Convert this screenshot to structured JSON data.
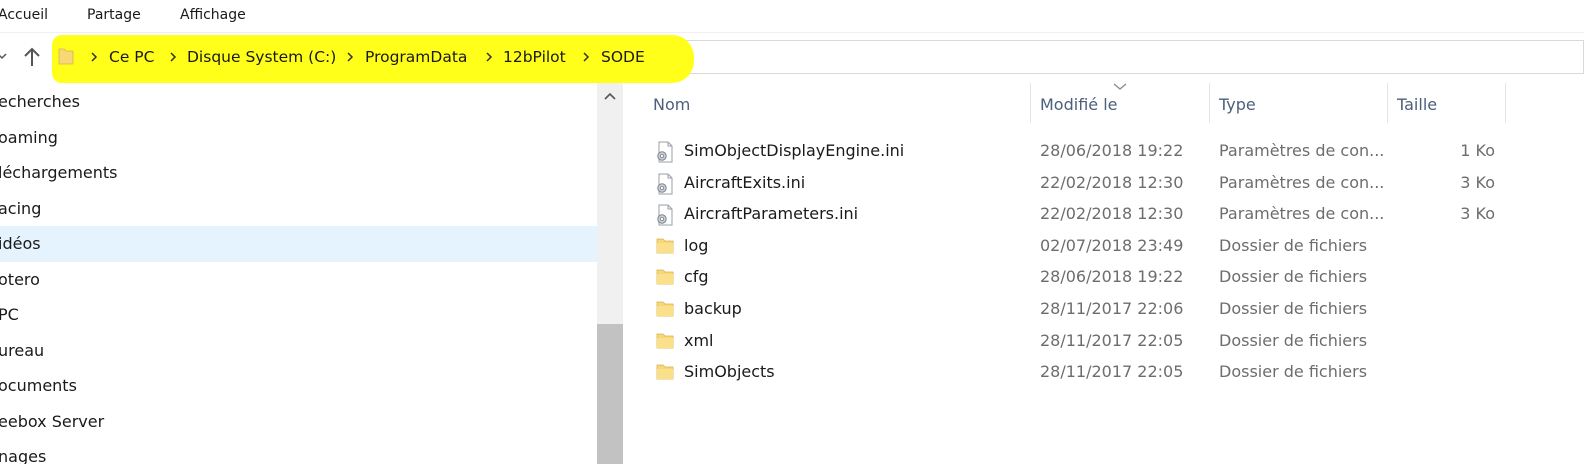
{
  "ribbon": {
    "tabs": [
      "Accueil",
      "Partage",
      "Affichage"
    ]
  },
  "address": {
    "breadcrumbs": [
      "Ce PC",
      "Disque System (C:)",
      "ProgramData",
      "12bPilot",
      "SODE"
    ],
    "highlight_color": "#ffff1a"
  },
  "nav_pane": {
    "items": [
      {
        "label": "echerches",
        "selected": false
      },
      {
        "label": "oaming",
        "selected": false
      },
      {
        "label": "léchargements",
        "selected": false
      },
      {
        "label": "acing",
        "selected": false
      },
      {
        "label": "idéos",
        "selected": true
      },
      {
        "label": "otero",
        "selected": false
      },
      {
        "label": "PC",
        "selected": false
      },
      {
        "label": "ureau",
        "selected": false
      },
      {
        "label": "ocuments",
        "selected": false
      },
      {
        "label": "eebox Server",
        "selected": false
      },
      {
        "label": "nages",
        "selected": false
      }
    ]
  },
  "columns": {
    "name": "Nom",
    "modified": "Modifié le",
    "type": "Type",
    "size": "Taille"
  },
  "files": [
    {
      "name": "SimObjectDisplayEngine.ini",
      "modified": "28/06/2018 19:22",
      "type": "Paramètres de con...",
      "size": "1 Ko",
      "icon": "ini-file-icon"
    },
    {
      "name": "AircraftExits.ini",
      "modified": "22/02/2018 12:30",
      "type": "Paramètres de con...",
      "size": "3 Ko",
      "icon": "ini-file-icon"
    },
    {
      "name": "AircraftParameters.ini",
      "modified": "22/02/2018 12:30",
      "type": "Paramètres de con...",
      "size": "3 Ko",
      "icon": "ini-file-icon"
    },
    {
      "name": "log",
      "modified": "02/07/2018 23:49",
      "type": "Dossier de fichiers",
      "size": "",
      "icon": "folder-icon"
    },
    {
      "name": "cfg",
      "modified": "28/06/2018 19:22",
      "type": "Dossier de fichiers",
      "size": "",
      "icon": "folder-icon"
    },
    {
      "name": "backup",
      "modified": "28/11/2017 22:06",
      "type": "Dossier de fichiers",
      "size": "",
      "icon": "folder-icon"
    },
    {
      "name": "xml",
      "modified": "28/11/2017 22:05",
      "type": "Dossier de fichiers",
      "size": "",
      "icon": "folder-icon"
    },
    {
      "name": "SimObjects",
      "modified": "28/11/2017 22:05",
      "type": "Dossier de fichiers",
      "size": "",
      "icon": "folder-icon"
    }
  ],
  "colors": {
    "folder": "#f8d775",
    "selection": "#e5f3ff",
    "header_text": "#4c607a"
  }
}
